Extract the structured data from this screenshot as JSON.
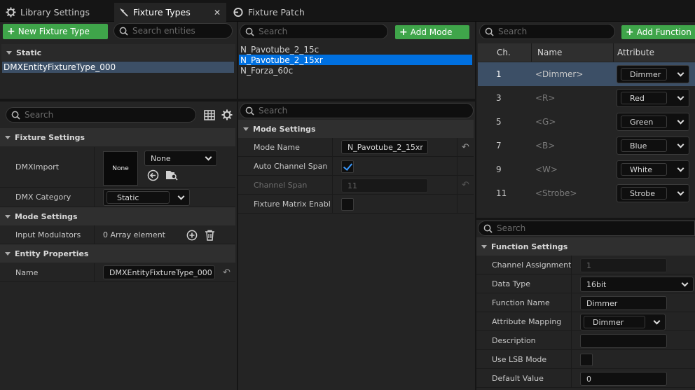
{
  "tabs": [
    {
      "label": "Library Settings",
      "icon": "gear-icon"
    },
    {
      "label": "Fixture Types",
      "icon": "fixture-icon",
      "active": true
    },
    {
      "label": "Fixture Patch",
      "icon": "patch-icon"
    }
  ],
  "left": {
    "new_fixture_type": "New Fixture Type",
    "search_entities_placeholder": "Search entities",
    "category_header": "Static",
    "entities": [
      "DMXEntityFixtureType_000"
    ],
    "details_search_placeholder": "Search",
    "fixture_settings": {
      "header": "Fixture Settings",
      "dmx_import_label": "DMXImport",
      "thumb_text": "None",
      "dmx_import_value": "None",
      "dmx_category_label": "DMX Category",
      "dmx_category_value": "Static"
    },
    "mode_settings": {
      "header": "Mode Settings",
      "input_modulators_label": "Input Modulators",
      "input_modulators_value": "0 Array element"
    },
    "entity_properties": {
      "header": "Entity Properties",
      "name_label": "Name",
      "name_value": "DMXEntityFixtureType_000"
    }
  },
  "middle": {
    "search_placeholder": "Search",
    "add_mode": "Add Mode",
    "modes": [
      "N_Pavotube_2_15c",
      "N_Pavotube_2_15xr",
      "N_Forza_60c"
    ],
    "selected_mode_index": 1,
    "details_search_placeholder": "Search",
    "mode_settings": {
      "header": "Mode Settings",
      "mode_name_label": "Mode Name",
      "mode_name_value": "N_Pavotube_2_15xr",
      "auto_channel_span_label": "Auto Channel Span",
      "auto_channel_span": true,
      "channel_span_label": "Channel Span",
      "channel_span_value": "11",
      "fixture_matrix_label": "Fixture Matrix Enabl...",
      "fixture_matrix": false
    }
  },
  "right": {
    "search_placeholder": "Search",
    "add_function": "Add Function",
    "columns": [
      "Ch.",
      "Name",
      "Attribute"
    ],
    "functions": [
      {
        "ch": "1",
        "name": "<Dimmer>",
        "attribute": "Dimmer",
        "selected": true
      },
      {
        "ch": "3",
        "name": "<R>",
        "attribute": "Red"
      },
      {
        "ch": "5",
        "name": "<G>",
        "attribute": "Green"
      },
      {
        "ch": "7",
        "name": "<B>",
        "attribute": "Blue"
      },
      {
        "ch": "9",
        "name": "<W>",
        "attribute": "White"
      },
      {
        "ch": "11",
        "name": "<Strobe>",
        "attribute": "Strobe"
      }
    ],
    "details_search_placeholder": "Search",
    "function_settings": {
      "header": "Function Settings",
      "channel_assignment_label": "Channel Assignment",
      "channel_assignment_value": "1",
      "data_type_label": "Data Type",
      "data_type_value": "16bit",
      "function_name_label": "Function Name",
      "function_name_value": "Dimmer",
      "attribute_mapping_label": "Attribute Mapping",
      "attribute_mapping_value": "Dimmer",
      "description_label": "Description",
      "description_value": "",
      "use_lsb_label": "Use LSB Mode",
      "use_lsb": false,
      "default_value_label": "Default Value",
      "default_value": "0"
    }
  },
  "colors": {
    "accent_green": "#3fa54a",
    "selection_blue": "#0070e0",
    "row_selected": "#3c4f66",
    "panel_bg": "#242424"
  }
}
